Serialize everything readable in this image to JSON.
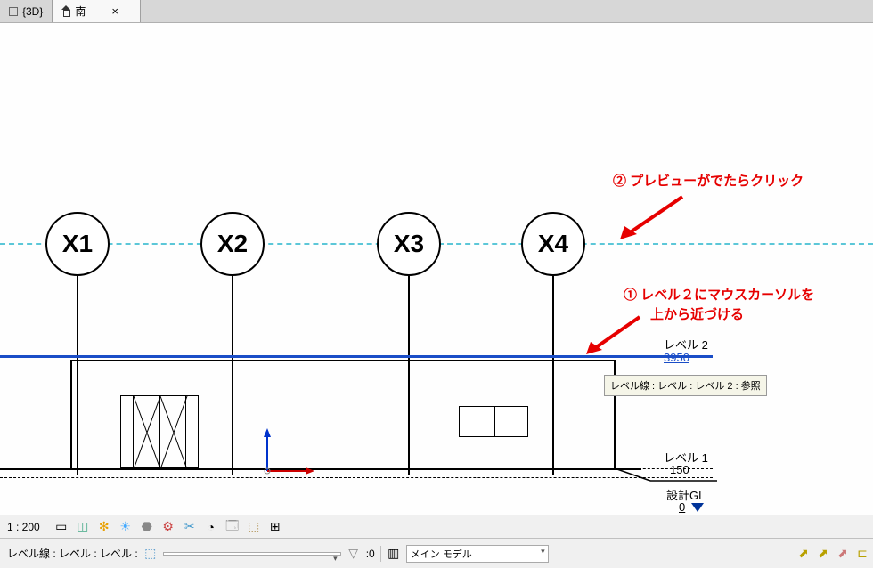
{
  "tabs": {
    "inactive": "{3D}",
    "active": "南",
    "close": "×"
  },
  "grid_bubbles": [
    "X1",
    "X2",
    "X3",
    "X4"
  ],
  "levels": {
    "level2": {
      "label": "レベル 2",
      "value": "3950"
    },
    "level1": {
      "label": "レベル 1",
      "value": "150"
    },
    "gl": {
      "label": "設計GL",
      "value": "0"
    }
  },
  "annotations": {
    "step2": "② プレビューがでたらクリック",
    "step1_line1": "① レベル２にマウスカーソルを",
    "step1_line2": "上から近づける"
  },
  "tooltip": "レベル線 : レベル : レベル 2 : 参照",
  "view_toolbar": {
    "scale": "1 : 200"
  },
  "status_bar": {
    "label": "レベル線 : レベル : レベル :",
    "zero": ":0",
    "model": "メイン モデル"
  }
}
